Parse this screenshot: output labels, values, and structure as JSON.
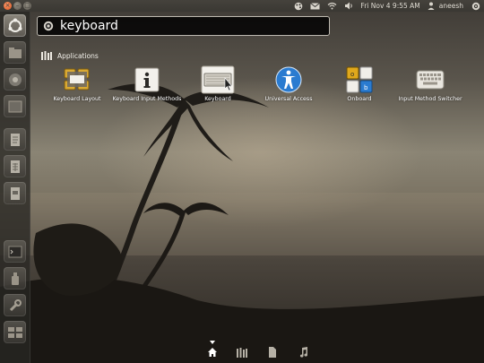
{
  "panel": {
    "clock": "Fri Nov  4  9:55 AM",
    "user": "aneesh",
    "tray_icons": [
      "color-palette-icon",
      "mail-icon",
      "network-wifi-icon",
      "volume-icon",
      "power-gear-icon"
    ]
  },
  "launcher": {
    "items": [
      "dash-home-icon",
      "files-icon",
      "chrome-browser-icon",
      "workspace-icon",
      "document-icon",
      "spreadsheet-icon",
      "presentation-icon",
      "terminal-icon",
      "usb-drive-icon",
      "system-settings-icon",
      "workspaces-switcher-icon"
    ]
  },
  "search": {
    "query": "keyboard"
  },
  "category": {
    "title": "Applications"
  },
  "results": [
    {
      "label": "Keyboard Layout",
      "icon": "keyboard-layout-icon"
    },
    {
      "label": "Keyboard Input Methods",
      "icon": "info-icon"
    },
    {
      "label": "Keyboard",
      "icon": "keyboard-icon"
    },
    {
      "label": "Universal Access",
      "icon": "universal-access-icon"
    },
    {
      "label": "Onboard",
      "icon": "onboard-icon"
    },
    {
      "label": "Input Method Switcher",
      "icon": "input-method-switcher-icon"
    }
  ],
  "lenses": [
    "home-icon",
    "applications-lens-icon",
    "files-lens-icon",
    "music-lens-icon"
  ],
  "colors": {
    "accent_orange": "#e05a23",
    "panel": "#3c3b37",
    "highlight_blue": "#2a7bd0",
    "text": "#ffffff"
  }
}
